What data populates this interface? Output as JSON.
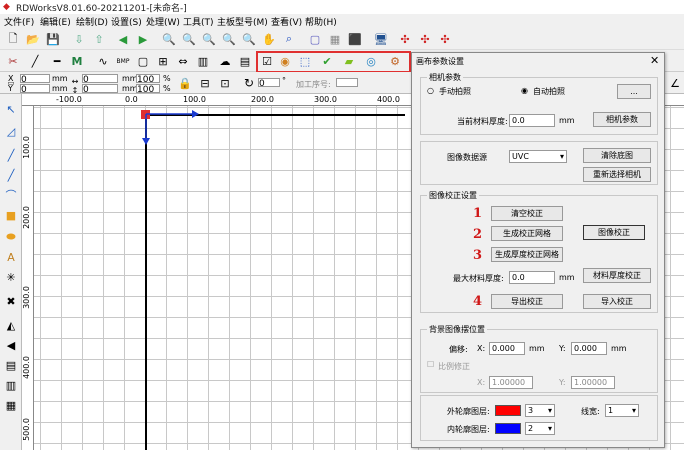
{
  "title": "RDWorksV8.01.60-20211201-[未命名-]",
  "menu": [
    "文件(F)",
    "编辑(E)",
    "绘制(D)",
    "设置(S)",
    "处理(W)",
    "工具(T)",
    "主板型号(M)",
    "查看(V)",
    "帮助(H)"
  ],
  "coords": {
    "x_label": "X",
    "y_label": "Y",
    "x_val": "0",
    "y_val": "0",
    "x_unit": "mm",
    "y_unit": "mm",
    "w_unit": "mm",
    "h_unit": "mm",
    "pct1": "%",
    "pct2": "%",
    "w_val": "0",
    "h_val": "0",
    "pct_w": "100",
    "pct_h": "100"
  },
  "rotate": {
    "value": "0",
    "unit": "°"
  },
  "order_label": "加工序号:",
  "ruler_h": [
    "-100.0",
    "0.0",
    "100.0",
    "200.0",
    "300.0",
    "400.0"
  ],
  "ruler_v": [
    "100.0",
    "200.0",
    "300.0",
    "400.0",
    "500.0"
  ],
  "dialog": {
    "title": "画布参数设置",
    "camera": {
      "group": "相机参数",
      "manual": "手动拍照",
      "auto": "自动拍照",
      "dots": "...",
      "thick_label": "当前材料厚度:",
      "thick_val": "0.0",
      "thick_unit": "mm",
      "params_btn": "相机参数"
    },
    "imgsrc": {
      "label": "图像数据源",
      "value": "UVC",
      "clear": "清除底图",
      "reselect": "重新选择相机"
    },
    "calib": {
      "group": "图像校正设置",
      "clear": "清空校正",
      "grid": "生成校正网格",
      "img_calib": "图像校正",
      "thick_grid": "生成厚度校正网格",
      "max_label": "最大材料厚度:",
      "max_val": "0.0",
      "max_unit": "mm",
      "mat_calib": "材料厚度校正",
      "export": "导出校正",
      "import": "导入校正",
      "n1": "1",
      "n2": "2",
      "n3": "3",
      "n4": "4"
    },
    "bg": {
      "group": "背景图像摆位置",
      "offset": "偏移:",
      "x": "X:",
      "y": "Y:",
      "x_val": "0.000",
      "y_val": "0.000",
      "unit": "mm",
      "ratio": "比例修正",
      "rx": "X:",
      "ry": "Y:",
      "rx_val": "1.00000",
      "ry_val": "1.00000"
    },
    "layers": {
      "outer": "外轮廓图层:",
      "outer_val": "3",
      "outer_color": "#ff0000",
      "inner": "内轮廓图层:",
      "inner_val": "2",
      "inner_color": "#0000ff",
      "linewidth": "线宽:",
      "lw_val": "1"
    }
  }
}
